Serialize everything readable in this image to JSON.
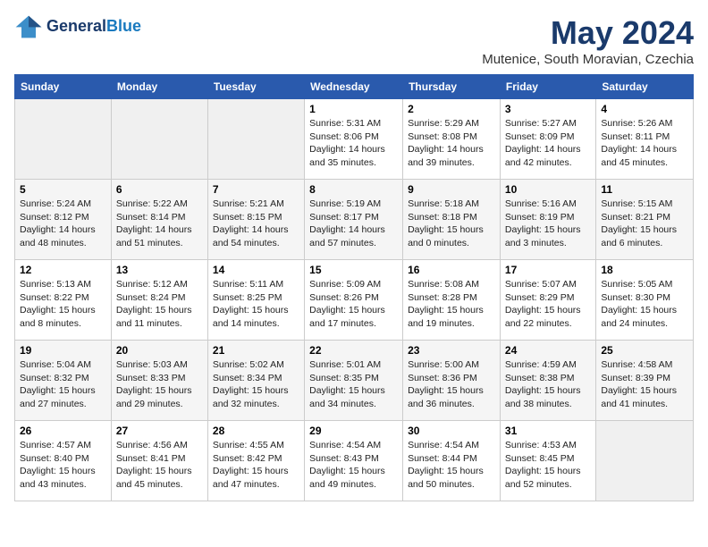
{
  "header": {
    "logo_line1": "General",
    "logo_line2": "Blue",
    "month": "May 2024",
    "location": "Mutenice, South Moravian, Czechia"
  },
  "weekdays": [
    "Sunday",
    "Monday",
    "Tuesday",
    "Wednesday",
    "Thursday",
    "Friday",
    "Saturday"
  ],
  "weeks": [
    [
      {
        "day": "",
        "info": ""
      },
      {
        "day": "",
        "info": ""
      },
      {
        "day": "",
        "info": ""
      },
      {
        "day": "1",
        "info": "Sunrise: 5:31 AM\nSunset: 8:06 PM\nDaylight: 14 hours and 35 minutes."
      },
      {
        "day": "2",
        "info": "Sunrise: 5:29 AM\nSunset: 8:08 PM\nDaylight: 14 hours and 39 minutes."
      },
      {
        "day": "3",
        "info": "Sunrise: 5:27 AM\nSunset: 8:09 PM\nDaylight: 14 hours and 42 minutes."
      },
      {
        "day": "4",
        "info": "Sunrise: 5:26 AM\nSunset: 8:11 PM\nDaylight: 14 hours and 45 minutes."
      }
    ],
    [
      {
        "day": "5",
        "info": "Sunrise: 5:24 AM\nSunset: 8:12 PM\nDaylight: 14 hours and 48 minutes."
      },
      {
        "day": "6",
        "info": "Sunrise: 5:22 AM\nSunset: 8:14 PM\nDaylight: 14 hours and 51 minutes."
      },
      {
        "day": "7",
        "info": "Sunrise: 5:21 AM\nSunset: 8:15 PM\nDaylight: 14 hours and 54 minutes."
      },
      {
        "day": "8",
        "info": "Sunrise: 5:19 AM\nSunset: 8:17 PM\nDaylight: 14 hours and 57 minutes."
      },
      {
        "day": "9",
        "info": "Sunrise: 5:18 AM\nSunset: 8:18 PM\nDaylight: 15 hours and 0 minutes."
      },
      {
        "day": "10",
        "info": "Sunrise: 5:16 AM\nSunset: 8:19 PM\nDaylight: 15 hours and 3 minutes."
      },
      {
        "day": "11",
        "info": "Sunrise: 5:15 AM\nSunset: 8:21 PM\nDaylight: 15 hours and 6 minutes."
      }
    ],
    [
      {
        "day": "12",
        "info": "Sunrise: 5:13 AM\nSunset: 8:22 PM\nDaylight: 15 hours and 8 minutes."
      },
      {
        "day": "13",
        "info": "Sunrise: 5:12 AM\nSunset: 8:24 PM\nDaylight: 15 hours and 11 minutes."
      },
      {
        "day": "14",
        "info": "Sunrise: 5:11 AM\nSunset: 8:25 PM\nDaylight: 15 hours and 14 minutes."
      },
      {
        "day": "15",
        "info": "Sunrise: 5:09 AM\nSunset: 8:26 PM\nDaylight: 15 hours and 17 minutes."
      },
      {
        "day": "16",
        "info": "Sunrise: 5:08 AM\nSunset: 8:28 PM\nDaylight: 15 hours and 19 minutes."
      },
      {
        "day": "17",
        "info": "Sunrise: 5:07 AM\nSunset: 8:29 PM\nDaylight: 15 hours and 22 minutes."
      },
      {
        "day": "18",
        "info": "Sunrise: 5:05 AM\nSunset: 8:30 PM\nDaylight: 15 hours and 24 minutes."
      }
    ],
    [
      {
        "day": "19",
        "info": "Sunrise: 5:04 AM\nSunset: 8:32 PM\nDaylight: 15 hours and 27 minutes."
      },
      {
        "day": "20",
        "info": "Sunrise: 5:03 AM\nSunset: 8:33 PM\nDaylight: 15 hours and 29 minutes."
      },
      {
        "day": "21",
        "info": "Sunrise: 5:02 AM\nSunset: 8:34 PM\nDaylight: 15 hours and 32 minutes."
      },
      {
        "day": "22",
        "info": "Sunrise: 5:01 AM\nSunset: 8:35 PM\nDaylight: 15 hours and 34 minutes."
      },
      {
        "day": "23",
        "info": "Sunrise: 5:00 AM\nSunset: 8:36 PM\nDaylight: 15 hours and 36 minutes."
      },
      {
        "day": "24",
        "info": "Sunrise: 4:59 AM\nSunset: 8:38 PM\nDaylight: 15 hours and 38 minutes."
      },
      {
        "day": "25",
        "info": "Sunrise: 4:58 AM\nSunset: 8:39 PM\nDaylight: 15 hours and 41 minutes."
      }
    ],
    [
      {
        "day": "26",
        "info": "Sunrise: 4:57 AM\nSunset: 8:40 PM\nDaylight: 15 hours and 43 minutes."
      },
      {
        "day": "27",
        "info": "Sunrise: 4:56 AM\nSunset: 8:41 PM\nDaylight: 15 hours and 45 minutes."
      },
      {
        "day": "28",
        "info": "Sunrise: 4:55 AM\nSunset: 8:42 PM\nDaylight: 15 hours and 47 minutes."
      },
      {
        "day": "29",
        "info": "Sunrise: 4:54 AM\nSunset: 8:43 PM\nDaylight: 15 hours and 49 minutes."
      },
      {
        "day": "30",
        "info": "Sunrise: 4:54 AM\nSunset: 8:44 PM\nDaylight: 15 hours and 50 minutes."
      },
      {
        "day": "31",
        "info": "Sunrise: 4:53 AM\nSunset: 8:45 PM\nDaylight: 15 hours and 52 minutes."
      },
      {
        "day": "",
        "info": ""
      }
    ]
  ]
}
